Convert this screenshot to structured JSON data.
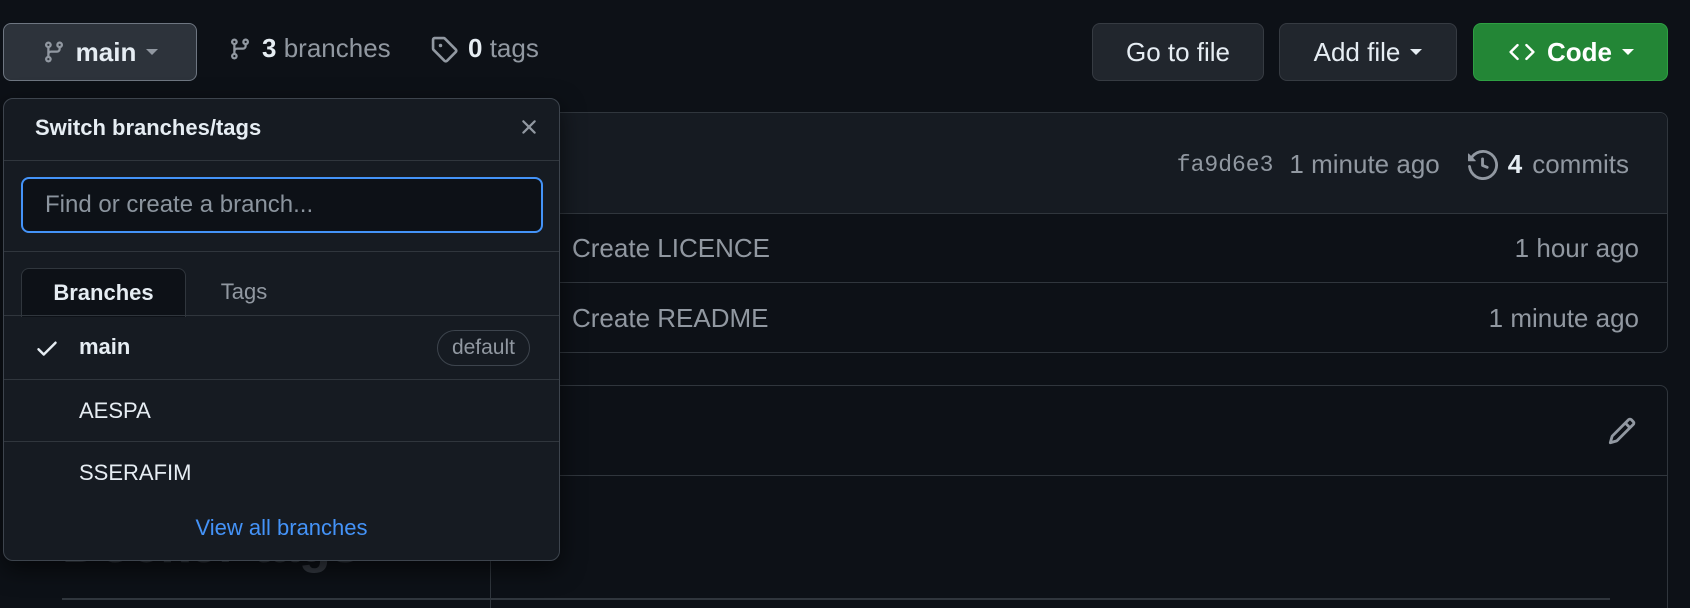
{
  "toolbar": {
    "branch_button": "main",
    "branches_count": "3",
    "branches_label": "branches",
    "tags_count": "0",
    "tags_label": "tags",
    "go_to_file": "Go to file",
    "add_file": "Add file",
    "code": "Code"
  },
  "latest_commit": {
    "sha": "fa9d6e3",
    "time": "1 minute ago",
    "commits_count": "4",
    "commits_label": "commits"
  },
  "files": [
    {
      "message": "Create LICENCE",
      "time": "1 hour ago"
    },
    {
      "message": "Create README",
      "time": "1 minute ago"
    }
  ],
  "readme": {
    "heading_partial": "Docker tags"
  },
  "dropdown": {
    "title": "Switch branches/tags",
    "search_placeholder": "Find or create a branch...",
    "tabs": [
      "Branches",
      "Tags"
    ],
    "branches": [
      {
        "name": "main",
        "selected": true,
        "badge": "default"
      },
      {
        "name": "AESPA"
      },
      {
        "name": "SSERAFIM"
      }
    ],
    "view_all": "View all branches"
  },
  "colors": {
    "background": "#0d1117",
    "panel": "#161b22",
    "accent_blue": "#4493f8",
    "code_green": "#238636"
  }
}
